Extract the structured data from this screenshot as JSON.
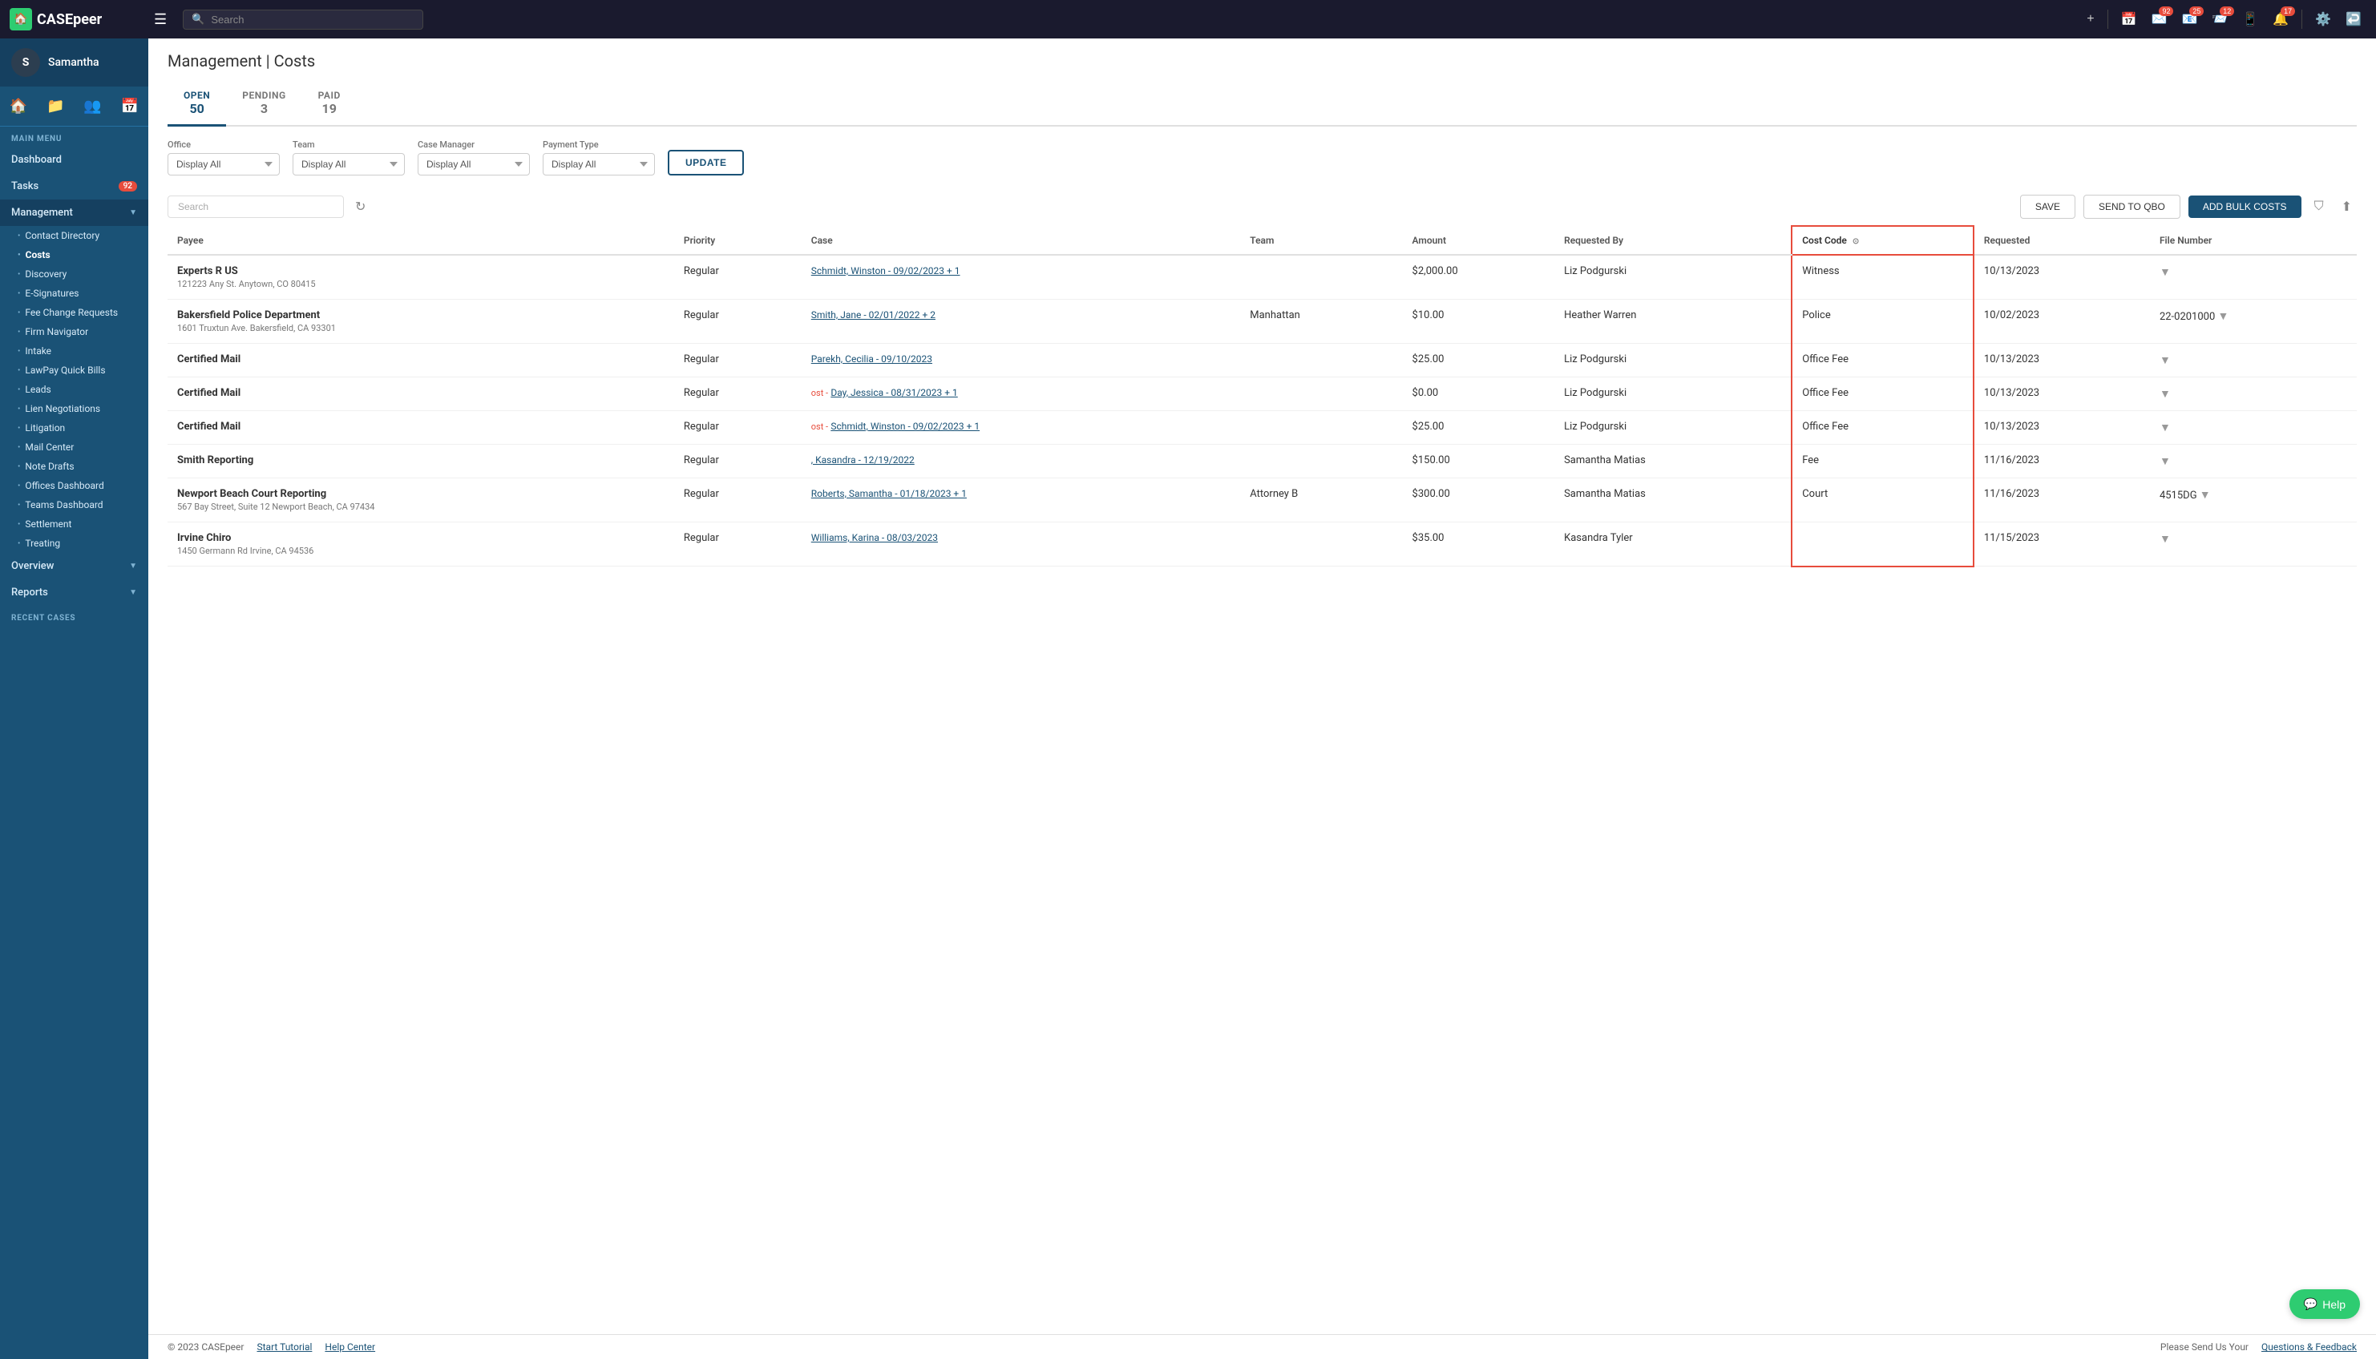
{
  "app": {
    "name": "CASEpeer",
    "logo_icon": "🏠"
  },
  "topnav": {
    "search_placeholder": "Search",
    "hamburger_label": "☰",
    "plus_icon": "+",
    "badges": {
      "calendar": null,
      "email1": "92",
      "email2": "25",
      "mail": "12",
      "mobile": null,
      "bell": "17"
    }
  },
  "sidebar": {
    "username": "Samantha",
    "main_menu_label": "MAIN MENU",
    "items": [
      {
        "label": "Dashboard",
        "type": "top",
        "badge": null
      },
      {
        "label": "Tasks",
        "type": "top",
        "badge": "92"
      },
      {
        "label": "Management",
        "type": "top",
        "badge": null,
        "expanded": true
      }
    ],
    "sub_items": [
      {
        "label": "Contact Directory"
      },
      {
        "label": "Costs",
        "active": true
      },
      {
        "label": "Discovery"
      },
      {
        "label": "E-Signatures"
      },
      {
        "label": "Fee Change Requests"
      },
      {
        "label": "Firm Navigator"
      },
      {
        "label": "Intake"
      },
      {
        "label": "LawPay Quick Bills"
      },
      {
        "label": "Leads"
      },
      {
        "label": "Lien Negotiations"
      },
      {
        "label": "Litigation"
      },
      {
        "label": "Mail Center"
      },
      {
        "label": "Note Drafts"
      },
      {
        "label": "Offices Dashboard"
      },
      {
        "label": "Teams Dashboard"
      },
      {
        "label": "Settlement"
      },
      {
        "label": "Treating"
      }
    ],
    "overview_label": "Overview",
    "reports_label": "Reports",
    "recent_cases_label": "RECENT CASES"
  },
  "page": {
    "title": "Management | Costs"
  },
  "tabs": [
    {
      "label": "OPEN",
      "count": "50",
      "active": true
    },
    {
      "label": "PENDING",
      "count": "3",
      "active": false
    },
    {
      "label": "PAID",
      "count": "19",
      "active": false
    }
  ],
  "filters": {
    "office_label": "Office",
    "office_value": "Display All",
    "team_label": "Team",
    "team_value": "Display All",
    "case_manager_label": "Case Manager",
    "case_manager_value": "Display All",
    "payment_type_label": "Payment Type",
    "payment_type_value": "Display All",
    "update_btn": "UPDATE"
  },
  "toolbar": {
    "search_placeholder": "Search",
    "save_btn": "SAVE",
    "send_qbo_btn": "SEND TO QBO",
    "add_bulk_btn": "ADD BULK COSTS"
  },
  "table": {
    "columns": [
      {
        "label": "Payee",
        "key": "payee"
      },
      {
        "label": "Priority",
        "key": "priority"
      },
      {
        "label": "Case",
        "key": "case"
      },
      {
        "label": "Team",
        "key": "team"
      },
      {
        "label": "Amount",
        "key": "amount"
      },
      {
        "label": "Requested By",
        "key": "requested_by"
      },
      {
        "label": "Cost Code",
        "key": "cost_code",
        "highlighted": true
      },
      {
        "label": "Requested",
        "key": "requested"
      },
      {
        "label": "File Number",
        "key": "file_number"
      }
    ],
    "rows": [
      {
        "payee_name": "Experts R US",
        "payee_address": "121223 Any St. Anytown, CO 80415",
        "priority": "Regular",
        "case": "Schmidt, Winston - 09/02/2023 + 1",
        "team": "",
        "amount": "$2,000.00",
        "requested_by": "Liz Podgurski",
        "cost_code": "Witness",
        "requested": "10/13/2023",
        "file_number": "",
        "has_dropdown": true,
        "prefix": ""
      },
      {
        "payee_name": "Bakersfield Police Department",
        "payee_address": "1601 Truxtun Ave. Bakersfield, CA 93301",
        "priority": "Regular",
        "case": "Smith, Jane - 02/01/2022 + 2",
        "team": "Manhattan",
        "amount": "$10.00",
        "requested_by": "Heather Warren",
        "cost_code": "Police",
        "requested": "10/02/2023",
        "file_number": "22-0201000",
        "has_dropdown": true,
        "prefix": ""
      },
      {
        "payee_name": "Certified Mail",
        "payee_address": "",
        "priority": "Regular",
        "case": "Parekh, Cecilia - 09/10/2023",
        "team": "",
        "amount": "$25.00",
        "requested_by": "Liz Podgurski",
        "cost_code": "Office Fee",
        "requested": "10/13/2023",
        "file_number": "",
        "has_dropdown": true,
        "prefix": ""
      },
      {
        "payee_name": "Certified Mail",
        "payee_address": "",
        "priority": "Regular",
        "case": "Day, Jessica - 08/31/2023 + 1",
        "team": "",
        "amount": "$0.00",
        "requested_by": "Liz Podgurski",
        "cost_code": "Office Fee",
        "requested": "10/13/2023",
        "file_number": "",
        "has_dropdown": true,
        "prefix": "ost -"
      },
      {
        "payee_name": "Certified Mail",
        "payee_address": "",
        "priority": "Regular",
        "case": "Schmidt, Winston - 09/02/2023 + 1",
        "team": "",
        "amount": "$25.00",
        "requested_by": "Liz Podgurski",
        "cost_code": "Office Fee",
        "requested": "10/13/2023",
        "file_number": "",
        "has_dropdown": true,
        "prefix": "ost -"
      },
      {
        "payee_name": "Smith Reporting",
        "payee_address": "",
        "priority": "Regular",
        "case": ", Kasandra - 12/19/2022",
        "team": "",
        "amount": "$150.00",
        "requested_by": "Samantha Matias",
        "cost_code": "Fee",
        "requested": "11/16/2023",
        "file_number": "",
        "has_dropdown": true,
        "prefix": ""
      },
      {
        "payee_name": "Newport Beach Court Reporting",
        "payee_address": "567 Bay Street, Suite 12 Newport Beach, CA 97434",
        "priority": "Regular",
        "case": "Roberts, Samantha - 01/18/2023 + 1",
        "team": "Attorney B",
        "amount": "$300.00",
        "requested_by": "Samantha Matias",
        "cost_code": "Court",
        "requested": "11/16/2023",
        "file_number": "4515DG",
        "has_dropdown": true,
        "prefix": ""
      },
      {
        "payee_name": "Irvine Chiro",
        "payee_address": "1450 Germann Rd Irvine, CA 94536",
        "priority": "Regular",
        "case": "Williams, Karina - 08/03/2023",
        "team": "",
        "amount": "$35.00",
        "requested_by": "Kasandra Tyler",
        "cost_code": "",
        "requested": "11/15/2023",
        "file_number": "",
        "has_dropdown": true,
        "prefix": ""
      }
    ]
  },
  "footer": {
    "copyright": "© 2023 CASEpeer",
    "start_tutorial": "Start Tutorial",
    "help_center": "Help Center",
    "feedback_prefix": "Please Send Us Your",
    "feedback_link": "Questions & Feedback"
  },
  "help_button": {
    "label": "Help"
  }
}
